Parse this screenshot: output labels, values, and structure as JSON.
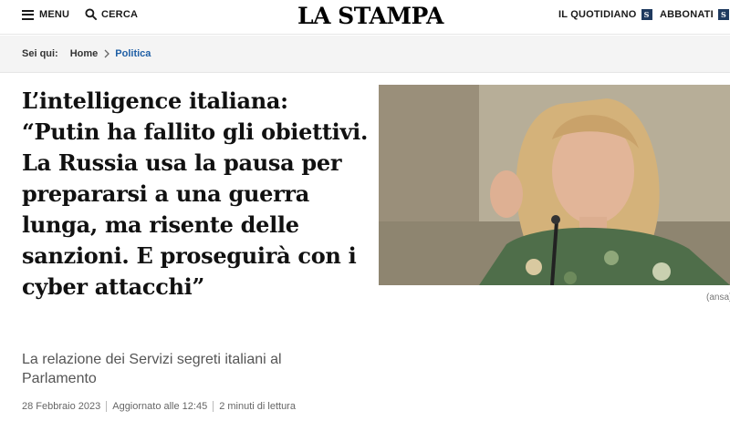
{
  "header": {
    "menu_label": "MENU",
    "search_label": "CERCA",
    "logo_text": "LA STAMPA",
    "quotidiano_label": "IL QUOTIDIANO",
    "abbonati_label": "ABBONATI",
    "badge_letter": "S"
  },
  "breadcrumb": {
    "intro": "Sei qui:",
    "items": [
      "Home",
      "Politica"
    ]
  },
  "article": {
    "headline": "L’intelligence italiana: “Putin ha fallito gli obiettivi. La Russia usa la pausa per prepararsi a una guerra lunga, ma risente delle sanzioni. E proseguirà con i cyber attacchi”",
    "subtitle": "La relazione dei Servizi segreti italiani al Parlamento",
    "date": "28 Febbraio 2023",
    "updated": "Aggiornato alle 12:45",
    "reading_time": "2 minuti di lettura",
    "photo_caption": "(ansa)"
  },
  "colors": {
    "link_blue": "#1f5fa5",
    "badge_navy": "#1f3a5f",
    "breadcrumb_bg": "#f4f4f4"
  },
  "icons": [
    "hamburger-icon",
    "search-icon",
    "chevron-right-icon",
    "newspaper-badge-icon"
  ]
}
